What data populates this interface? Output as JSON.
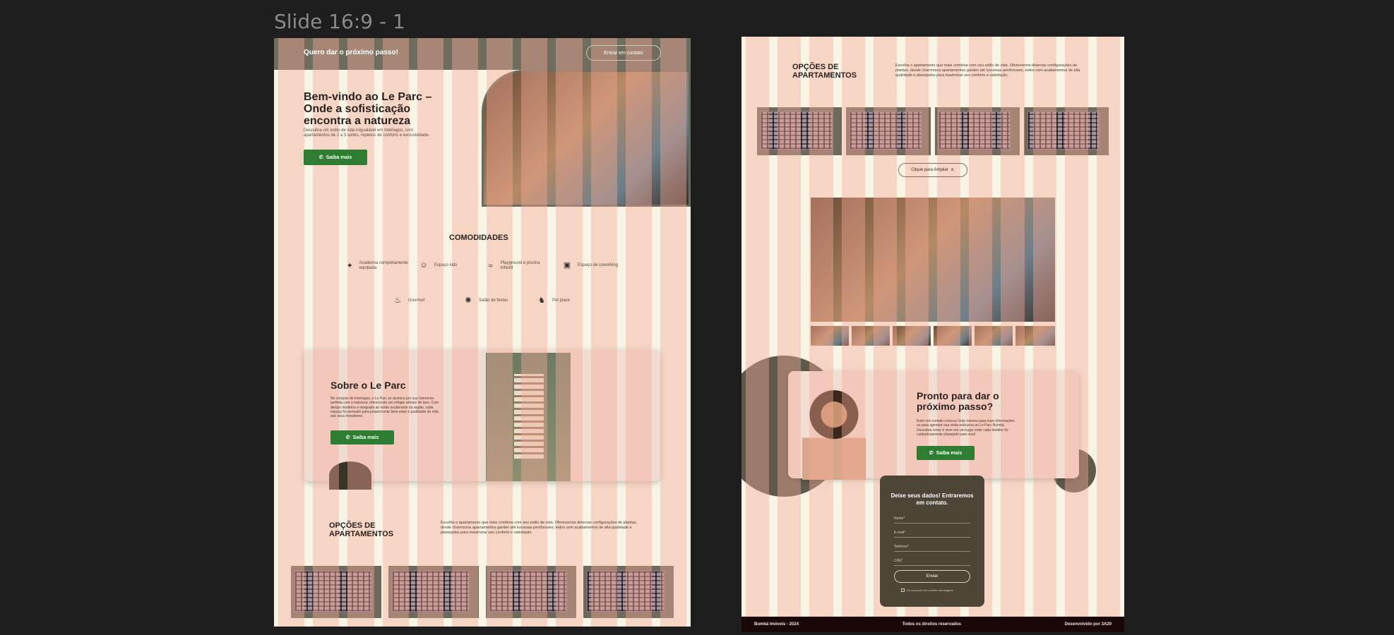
{
  "canvas": {
    "frame_label": "Slide 16:9 - 1"
  },
  "page1": {
    "topbar": {
      "title": "Quero dar o próximo passo!",
      "cta": "Entrar em contato"
    },
    "hero": {
      "heading": "Bem-vindo ao Le Parc – Onde a sofisticação encontra a natureza",
      "text": "Descubra um estilo de vida inigualável em Interlagos, com apartamentos de 2 a 3 suítes, repletos de conforto e exclusividade.",
      "button": "Saiba mais"
    },
    "amenities": {
      "title": "COMODIDADES",
      "items": [
        {
          "label": "Academia completamente equipada",
          "icon": "dumbbell-icon"
        },
        {
          "label": "Espaço kids",
          "icon": "kids-icon"
        },
        {
          "label": "Playground e piscina infantil",
          "icon": "pool-icon"
        },
        {
          "label": "Espaço de coworking",
          "icon": "briefcase-icon"
        },
        {
          "label": "Gourmet",
          "icon": "gourmet-icon"
        },
        {
          "label": "Salão de festas",
          "icon": "party-icon"
        },
        {
          "label": "Pet place",
          "icon": "pet-icon"
        }
      ]
    },
    "about": {
      "title": "Sobre o Le Parc",
      "text": "No coração de Interlagos, o Le Parc se destaca por sua harmonia perfeita com a natureza, oferecendo um refúgio urbano de luxo. Com design moderno e integrado ao verde exuberante da região, cada espaço foi pensado para proporcionar bem-estar e qualidade de vida aos seus moradores.",
      "button": "Saiba mais"
    },
    "options": {
      "title": "OPÇÕES DE APARTAMENTOS",
      "text": "Escolha o apartamento que mais combina com seu estilo de vida. Oferecemos diversas configurações de plantas, desde charmosos apartamentos garden até luxuosas penthouses, todos com acabamentos de alta qualidade e planejados para maximizar seu conforto e satisfação."
    }
  },
  "page2": {
    "options": {
      "title": "OPÇÕES DE APARTAMENTOS",
      "text": "Escolha o apartamento que mais combina com seu estilo de vida. Oferecemos diversas configurações de plantas, desde charmosos apartamentos garden até luxuosas penthouses, todos com acabamentos de alta qualidade e planejados para maximizar seu conforto e satisfação.",
      "zoom_button": "Clique para Ampliar"
    },
    "next_step": {
      "title": "Pronto para dar o próximo passo?",
      "text": "Entre em contato conosco hoje mesmo para mais informações ou para agendar sua visita exclusiva ao Le Parc Bumbá. Descubra como é viver em um lugar onde cada detalhe foi cuidadosamente planejado para você.",
      "button": "Saiba mais"
    },
    "form": {
      "title": "Deixe seus dados! Entraremos em contato.",
      "fields": [
        "Nome*",
        "E-mail*",
        "Telefone*",
        "CRE*"
      ],
      "submit": "Enviar",
      "consent": "Eu concordo em receber mensagens"
    },
    "footer": {
      "left": "Bumbá Imóveis - 2024",
      "center": "Todos os direitos reservados",
      "right": "Desenvolvido por 3A20"
    }
  },
  "colors": {
    "background": "#1e1e1e",
    "cream": "#f7f4e6",
    "salmon_columns": "#f6aa96",
    "olive": "#6d6a5c",
    "green": "#2e7d32",
    "dark_brown": "#4d4637"
  }
}
